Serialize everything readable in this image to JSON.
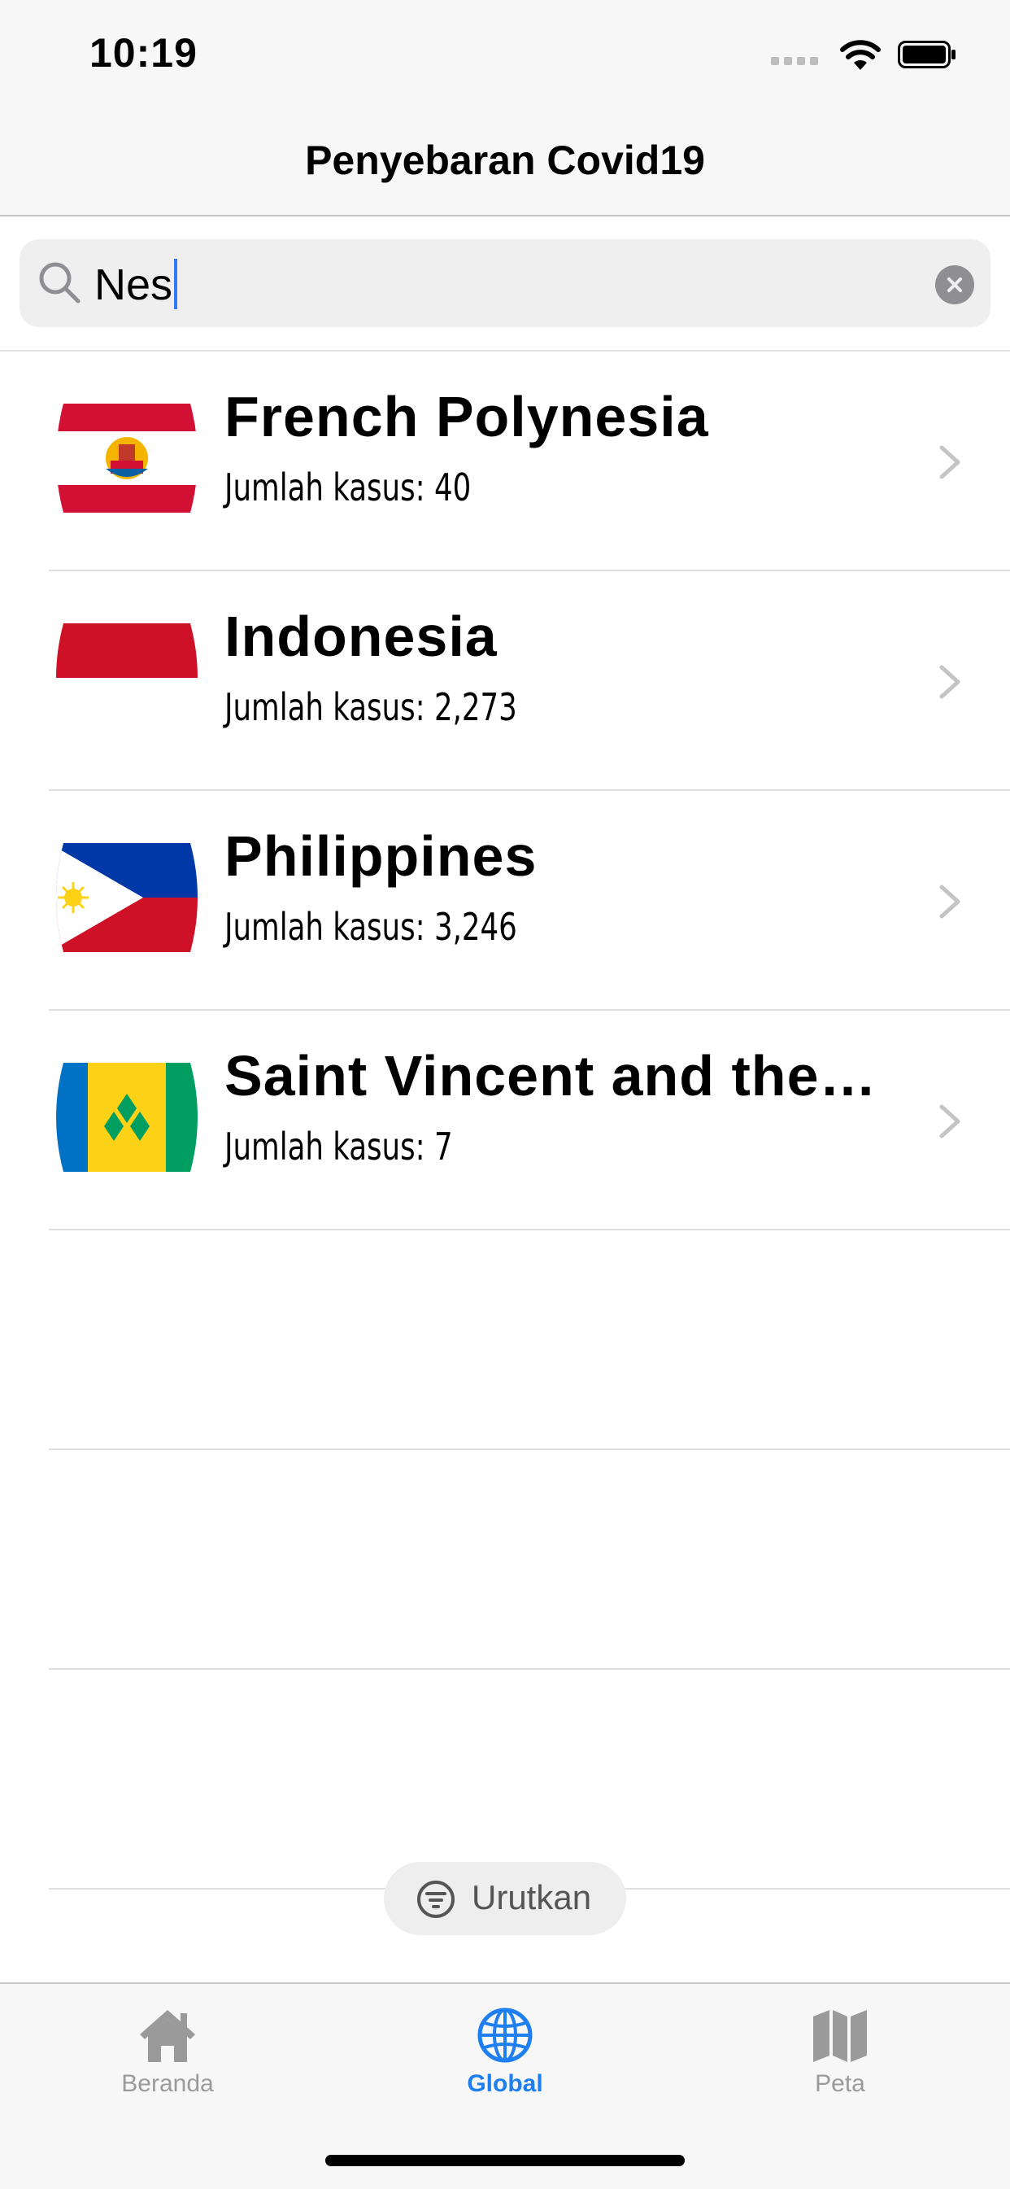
{
  "status_bar": {
    "time": "10:19"
  },
  "nav": {
    "title": "Penyebaran Covid19"
  },
  "search": {
    "value": "Nes"
  },
  "countries": [
    {
      "name": "French Polynesia",
      "cases": "Jumlah kasus: 40"
    },
    {
      "name": "Indonesia",
      "cases": "Jumlah kasus: 2,273"
    },
    {
      "name": "Philippines",
      "cases": "Jumlah kasus: 3,246"
    },
    {
      "name": "Saint Vincent and the…",
      "cases": "Jumlah kasus: 7"
    }
  ],
  "sort": {
    "label": "Urutkan"
  },
  "tabs": [
    {
      "label": "Beranda",
      "icon": "house-icon"
    },
    {
      "label": "Global",
      "icon": "globe-icon",
      "active": true
    },
    {
      "label": "Peta",
      "icon": "map-icon"
    }
  ],
  "colors": {
    "accent": "#1e7ff0",
    "inactive": "#9a9a9a"
  }
}
